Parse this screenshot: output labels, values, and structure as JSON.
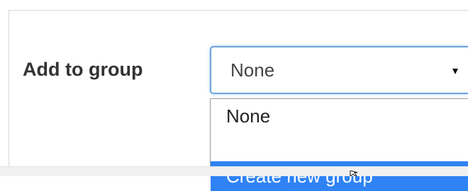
{
  "form": {
    "label": "Add to group",
    "select": {
      "selected_value": "None",
      "arrow_icon": "triangle-down-icon",
      "options": [
        {
          "label": "None",
          "highlighted": false
        },
        {
          "label": "Create new group",
          "highlighted": true
        }
      ]
    }
  },
  "colors": {
    "focus_border": "#6ba3dc",
    "highlight": "#2f83f5",
    "label_text": "#333333"
  },
  "pointer": {
    "icon": "mouse-pointer-icon"
  }
}
